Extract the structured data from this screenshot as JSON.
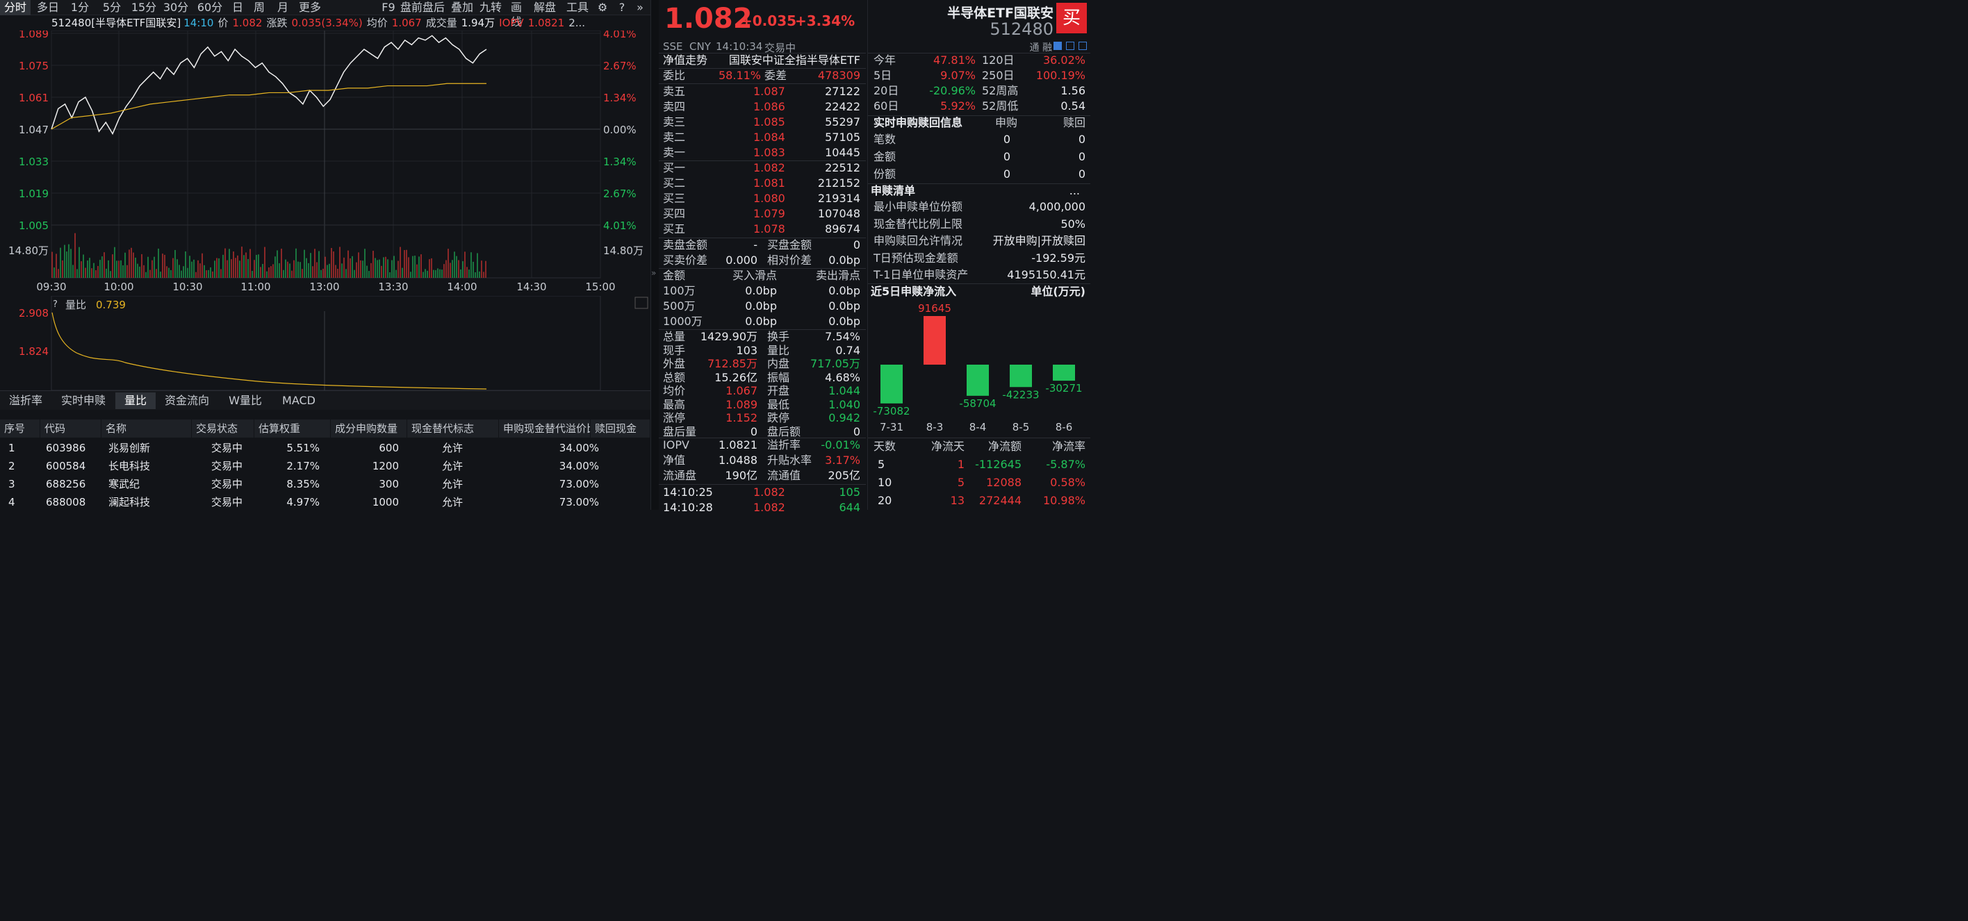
{
  "toolbar": {
    "items": [
      "分时",
      "多日",
      "1分",
      "5分",
      "15分",
      "30分",
      "60分",
      "日",
      "周",
      "月",
      "更多"
    ],
    "right_items": [
      "F9",
      "盘前盘后",
      "叠加",
      "九转",
      "画线",
      "解盘",
      "工具"
    ]
  },
  "info": {
    "code_name": "512480[半导体ETF国联安]",
    "time": "14:10",
    "price_label": "价",
    "price": "1.082",
    "change_label": "涨跌",
    "change": "0.035(3.34%)",
    "avg_label": "均价",
    "avg": "1.067",
    "vol_label": "成交量",
    "vol": "1.94万",
    "iopv_label": "IOPV",
    "iopv": "1.0821",
    "more": "2..."
  },
  "chart": {
    "y_left": [
      "1.089",
      "1.075",
      "1.061",
      "1.047",
      "1.033",
      "1.019",
      "1.005"
    ],
    "y_right": [
      "4.01%",
      "2.67%",
      "1.34%",
      "0.00%",
      "1.34%",
      "2.67%",
      "4.01%"
    ],
    "vol_label": "14.80万",
    "x_labels": [
      "09:30",
      "10:00",
      "10:30",
      "11:00",
      "13:00",
      "13:30",
      "14:00",
      "14:30",
      "15:00"
    ],
    "price_line": [
      1.047,
      1.056,
      1.058,
      1.052,
      1.059,
      1.061,
      1.055,
      1.046,
      1.05,
      1.045,
      1.052,
      1.057,
      1.061,
      1.066,
      1.069,
      1.072,
      1.069,
      1.074,
      1.071,
      1.076,
      1.078,
      1.074,
      1.08,
      1.083,
      1.079,
      1.081,
      1.077,
      1.082,
      1.079,
      1.077,
      1.074,
      1.076,
      1.072,
      1.07,
      1.067,
      1.063,
      1.061,
      1.058,
      1.064,
      1.061,
      1.057,
      1.06,
      1.066,
      1.072,
      1.076,
      1.079,
      1.082,
      1.08,
      1.078,
      1.083,
      1.085,
      1.082,
      1.086,
      1.084,
      1.087,
      1.086,
      1.088,
      1.085,
      1.087,
      1.084,
      1.082,
      1.078,
      1.076,
      1.08,
      1.082
    ],
    "avg_line": [
      1.047,
      1.052,
      1.053,
      1.054,
      1.056,
      1.058,
      1.059,
      1.06,
      1.061,
      1.062,
      1.062,
      1.063,
      1.063,
      1.064,
      1.064,
      1.065,
      1.065,
      1.066,
      1.066,
      1.066,
      1.067,
      1.067,
      1.067
    ],
    "ratio_label": "量比",
    "ratio_value": "0.739",
    "ratio_y": [
      "2.908",
      "1.824"
    ]
  },
  "tabs": [
    "溢折率",
    "实时申赎",
    "量比",
    "资金流向",
    "W量比",
    "MACD"
  ],
  "table": {
    "headers": [
      "序号",
      "代码",
      "名称",
      "交易状态",
      "估算权重",
      "成分申购数量",
      "现金替代标志",
      "申购现金替代溢价比率",
      "赎回现金"
    ],
    "rows": [
      [
        "1",
        "603986",
        "兆易创新",
        "交易中",
        "5.51%",
        "600",
        "允许",
        "34.00%"
      ],
      [
        "2",
        "600584",
        "长电科技",
        "交易中",
        "2.17%",
        "1200",
        "允许",
        "34.00%"
      ],
      [
        "3",
        "688256",
        "寒武纪",
        "交易中",
        "8.35%",
        "300",
        "允许",
        "73.00%"
      ],
      [
        "4",
        "688008",
        "澜起科技",
        "交易中",
        "4.97%",
        "1000",
        "允许",
        "73.00%"
      ]
    ]
  },
  "quote": {
    "price": "1.082",
    "change": "+0.035",
    "pct": "+3.34%",
    "name": "半导体ETF国联安",
    "code": "512480",
    "market": "SSE",
    "currency": "CNY",
    "time": "14:10:34",
    "status": "交易中",
    "tags": "通 融",
    "buy": "买"
  },
  "nav": {
    "label": "净值走势",
    "index": "国联安中证全指半导体ETF"
  },
  "commission": {
    "ratio_label": "委比",
    "ratio": "58.11%",
    "diff_label": "委差",
    "diff": "478309"
  },
  "asks": [
    [
      "卖五",
      "1.087",
      "27122"
    ],
    [
      "卖四",
      "1.086",
      "22422"
    ],
    [
      "卖三",
      "1.085",
      "55297"
    ],
    [
      "卖二",
      "1.084",
      "57105"
    ],
    [
      "卖一",
      "1.083",
      "10445"
    ]
  ],
  "bids": [
    [
      "买一",
      "1.082",
      "22512"
    ],
    [
      "买二",
      "1.081",
      "212152"
    ],
    [
      "买三",
      "1.080",
      "219314"
    ],
    [
      "买四",
      "1.079",
      "107048"
    ],
    [
      "买五",
      "1.078",
      "89674"
    ]
  ],
  "orderinfo": [
    [
      "卖盘金额",
      "-",
      "买盘金额",
      "0"
    ],
    [
      "买卖价差",
      "0.000",
      "相对价差",
      "0.0bp"
    ]
  ],
  "slippage": {
    "headers": [
      "金额",
      "买入滑点",
      "卖出滑点"
    ],
    "rows": [
      [
        "100万",
        "0.0bp",
        "0.0bp"
      ],
      [
        "500万",
        "0.0bp",
        "0.0bp"
      ],
      [
        "1000万",
        "0.0bp",
        "0.0bp"
      ]
    ]
  },
  "stats": [
    [
      "总量",
      "1429.90万",
      "换手",
      "7.54%"
    ],
    [
      "现手",
      "103",
      "量比",
      "0.74"
    ],
    [
      "外盘",
      "712.85万",
      "内盘",
      "717.05万"
    ],
    [
      "总额",
      "15.26亿",
      "振幅",
      "4.68%"
    ],
    [
      "均价",
      "1.067",
      "开盘",
      "1.044"
    ],
    [
      "最高",
      "1.089",
      "最低",
      "1.040"
    ],
    [
      "涨停",
      "1.152",
      "跌停",
      "0.942"
    ],
    [
      "盘后量",
      "0",
      "盘后额",
      "0"
    ]
  ],
  "iopv": [
    [
      "IOPV",
      "1.0821",
      "溢折率",
      "-0.01%"
    ],
    [
      "净值",
      "1.0488",
      "升贴水率",
      "3.17%"
    ],
    [
      "流通盘",
      "190亿",
      "流通值",
      "205亿"
    ]
  ],
  "ticks": [
    [
      "14:10:25",
      "1.082",
      "105"
    ],
    [
      "14:10:28",
      "1.082",
      "644"
    ]
  ],
  "perf": [
    [
      "今年",
      "47.81%",
      "120日",
      "36.02%"
    ],
    [
      "5日",
      "9.07%",
      "250日",
      "100.19%"
    ],
    [
      "20日",
      "-20.96%",
      "52周高",
      "1.56"
    ],
    [
      "60日",
      "5.92%",
      "52周低",
      "0.54"
    ]
  ],
  "redemption": {
    "title": "实时申购赎回信息",
    "col1": "申购",
    "col2": "赎回",
    "rows": [
      [
        "笔数",
        "0",
        "0"
      ],
      [
        "金额",
        "0",
        "0"
      ],
      [
        "份额",
        "0",
        "0"
      ]
    ]
  },
  "list": {
    "title": "申赎清单",
    "more": "...",
    "rows": [
      [
        "最小申赎单位份额",
        "4,000,000"
      ],
      [
        "现金替代比例上限",
        "50%"
      ],
      [
        "申购赎回允许情况",
        "开放申购|开放赎回"
      ],
      [
        "T日预估现金差额",
        "-192.59元"
      ],
      [
        "T-1日单位申赎资产",
        "4195150.41元"
      ]
    ]
  },
  "flow": {
    "title": "近5日申赎净流入",
    "unit": "单位(万元)",
    "bars": [
      {
        "date": "7-31",
        "value": -73082
      },
      {
        "date": "8-3",
        "value": 91645
      },
      {
        "date": "8-4",
        "value": -58704
      },
      {
        "date": "8-5",
        "value": -42233
      },
      {
        "date": "8-6",
        "value": -30271
      }
    ]
  },
  "flowtable": {
    "headers": [
      "天数",
      "净流天",
      "净流额",
      "净流率"
    ],
    "rows": [
      [
        "5",
        "1",
        "-112645",
        "-5.87%"
      ],
      [
        "10",
        "5",
        "12088",
        "0.58%"
      ],
      [
        "20",
        "13",
        "272444",
        "10.98%"
      ]
    ]
  },
  "colors": {
    "up": "#f03a3a",
    "down": "#21c25a",
    "avg": "#e6b422",
    "bg": "#121418"
  }
}
